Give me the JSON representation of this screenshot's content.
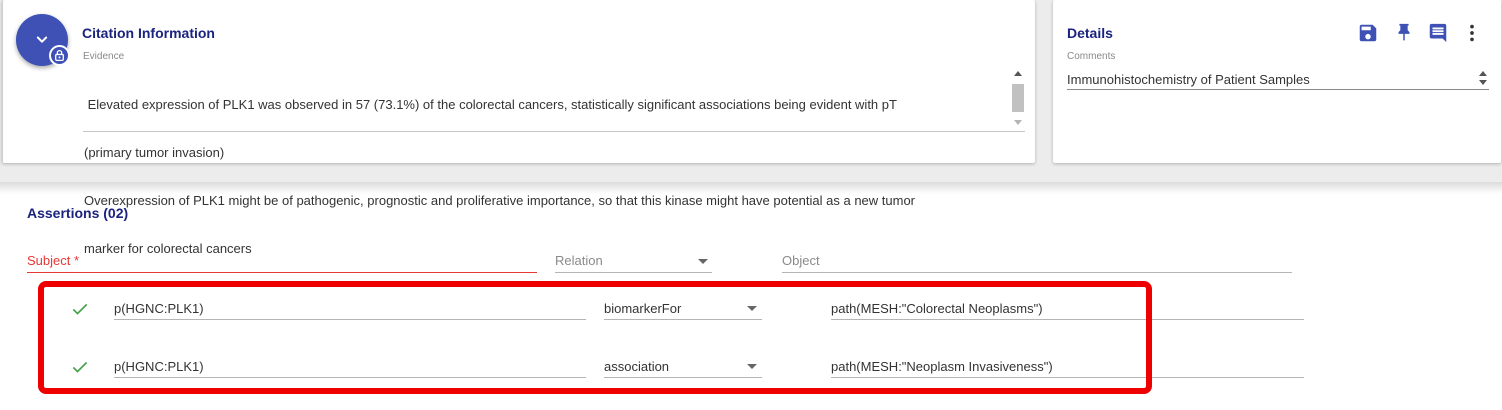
{
  "citation": {
    "title": "Citation Information",
    "evidence_label": "Evidence",
    "evidence_lines": [
      " Elevated expression of PLK1 was observed in 57 (73.1%) of the colorectal cancers, statistically significant associations being evident with pT",
      "(primary tumor invasion)",
      "Overexpression of PLK1 might be of pathogenic, prognostic and proliferative importance, so that this kinase might have potential as a new tumor",
      "marker for colorectal cancers"
    ]
  },
  "details": {
    "title": "Details",
    "comments_label": "Comments",
    "comments_value": "Immunohistochemistry of Patient Samples",
    "icons": [
      "save-icon",
      "pin-icon",
      "comment-icon",
      "more-vert-icon"
    ]
  },
  "assertions": {
    "title": "Assertions (02)",
    "subject_label": "Subject *",
    "relation_label": "Relation",
    "object_label": "Object",
    "rows": [
      {
        "subject": "p(HGNC:PLK1)",
        "relation": "biomarkerFor",
        "object": "path(MESH:\"Colorectal Neoplasms\")",
        "status": "check-icon"
      },
      {
        "subject": "p(HGNC:PLK1)",
        "relation": "association",
        "object": "path(MESH:\"Neoplasm Invasiveness\")",
        "status": "check-icon"
      }
    ]
  },
  "colors": {
    "primary": "#3f51b5",
    "title_navy": "#1a237e",
    "required_red": "#e53935",
    "highlight_red": "#ee0000",
    "check_green": "#43a047"
  }
}
